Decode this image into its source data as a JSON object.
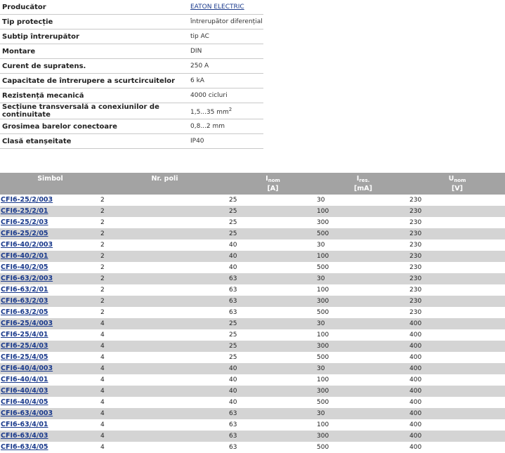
{
  "specs": [
    {
      "label": "Producător",
      "value": "EATON ELECTRIC",
      "link": true
    },
    {
      "label": "Tip protecție",
      "value": "întrerupător diferențial"
    },
    {
      "label": "Subtip întrerupător",
      "value": "tip AC"
    },
    {
      "label": "Montare",
      "value": "DIN"
    },
    {
      "label": "Curent de supratens.",
      "value": "250 A"
    },
    {
      "label": "Capacitate de întrerupere a scurtcircuitelor",
      "value": "6 kA"
    },
    {
      "label": "Rezistență mecanică",
      "value": "4000 cicluri"
    },
    {
      "label": "Secțiune transversală a conexiunilor de continuitate",
      "value": "1,5...35 mm",
      "sup": "2"
    },
    {
      "label": "Grosimea barelor conectoare",
      "value": "0,8...2 mm"
    },
    {
      "label": "Clasă etanșeitate",
      "value": "IP40"
    }
  ],
  "table": {
    "headers": {
      "symbol": "Simbol",
      "poles": "Nr. poli",
      "inom": {
        "main": "I",
        "sub": "nom",
        "unit": "[A]"
      },
      "ires": {
        "main": "I",
        "sub": "res.",
        "unit": "[mA]"
      },
      "unom": {
        "main": "U",
        "sub": "nom",
        "unit": "[V]"
      }
    },
    "rows": [
      [
        "CFI6-25/2/003",
        "2",
        "25",
        "30",
        "230"
      ],
      [
        "CFI6-25/2/01",
        "2",
        "25",
        "100",
        "230"
      ],
      [
        "CFI6-25/2/03",
        "2",
        "25",
        "300",
        "230"
      ],
      [
        "CFI6-25/2/05",
        "2",
        "25",
        "500",
        "230"
      ],
      [
        "CFI6-40/2/003",
        "2",
        "40",
        "30",
        "230"
      ],
      [
        "CFI6-40/2/01",
        "2",
        "40",
        "100",
        "230"
      ],
      [
        "CFI6-40/2/05",
        "2",
        "40",
        "500",
        "230"
      ],
      [
        "CFI6-63/2/003",
        "2",
        "63",
        "30",
        "230"
      ],
      [
        "CFI6-63/2/01",
        "2",
        "63",
        "100",
        "230"
      ],
      [
        "CFI6-63/2/03",
        "2",
        "63",
        "300",
        "230"
      ],
      [
        "CFI6-63/2/05",
        "2",
        "63",
        "500",
        "230"
      ],
      [
        "CFI6-25/4/003",
        "4",
        "25",
        "30",
        "400"
      ],
      [
        "CFI6-25/4/01",
        "4",
        "25",
        "100",
        "400"
      ],
      [
        "CFI6-25/4/03",
        "4",
        "25",
        "300",
        "400"
      ],
      [
        "CFI6-25/4/05",
        "4",
        "25",
        "500",
        "400"
      ],
      [
        "CFI6-40/4/003",
        "4",
        "40",
        "30",
        "400"
      ],
      [
        "CFI6-40/4/01",
        "4",
        "40",
        "100",
        "400"
      ],
      [
        "CFI6-40/4/03",
        "4",
        "40",
        "300",
        "400"
      ],
      [
        "CFI6-40/4/05",
        "4",
        "40",
        "500",
        "400"
      ],
      [
        "CFI6-63/4/003",
        "4",
        "63",
        "30",
        "400"
      ],
      [
        "CFI6-63/4/01",
        "4",
        "63",
        "100",
        "400"
      ],
      [
        "CFI6-63/4/03",
        "4",
        "63",
        "300",
        "400"
      ],
      [
        "CFI6-63/4/05",
        "4",
        "63",
        "500",
        "400"
      ]
    ]
  },
  "colors": {
    "header_bg": "#a3a3a3",
    "row_alt_bg": "#d4d4d4",
    "link": "#1a3a8c"
  }
}
